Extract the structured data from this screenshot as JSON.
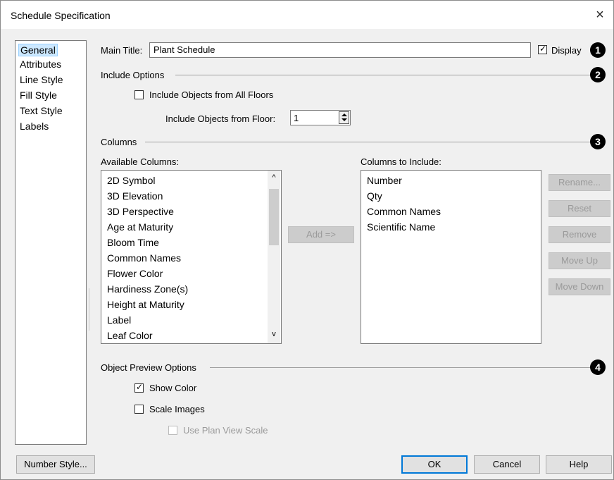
{
  "window": {
    "title": "Schedule Specification",
    "close_glyph": "×"
  },
  "sidebar": {
    "items": [
      "General",
      "Attributes",
      "Line Style",
      "Fill Style",
      "Text Style",
      "Labels"
    ],
    "selected": "General"
  },
  "main_title": {
    "label": "Main Title:",
    "value": "Plant Schedule",
    "display_label": "Display",
    "display_checked": true
  },
  "include_options": {
    "heading": "Include Options",
    "all_floors_label": "Include Objects from All Floors",
    "all_floors_checked": false,
    "from_floor_label": "Include Objects from Floor:",
    "from_floor_value": "1"
  },
  "columns": {
    "heading": "Columns",
    "available_label": "Available Columns:",
    "available": [
      "2D Symbol",
      "3D Elevation",
      "3D Perspective",
      "Age at Maturity",
      "Bloom Time",
      "Common Names",
      "Flower Color",
      "Hardiness Zone(s)",
      "Height at Maturity",
      "Label",
      "Leaf Color"
    ],
    "include_label": "Columns to Include:",
    "included": [
      "Number",
      "Qty",
      "Common Names",
      "Scientific Name"
    ],
    "add_button": "Add =>",
    "rename_button": "Rename...",
    "reset_button": "Reset",
    "remove_button": "Remove",
    "move_up_button": "Move Up",
    "move_down_button": "Move Down"
  },
  "preview": {
    "heading": "Object Preview Options",
    "show_color_label": "Show Color",
    "show_color_checked": true,
    "scale_images_label": "Scale Images",
    "scale_images_checked": false,
    "plan_scale_label": "Use Plan View Scale",
    "plan_scale_checked": false
  },
  "callouts": [
    "1",
    "2",
    "3",
    "4"
  ],
  "footer": {
    "number_style": "Number Style...",
    "ok": "OK",
    "cancel": "Cancel",
    "help": "Help"
  },
  "colors": {
    "selection": "#cce8ff",
    "accent": "#0078d7",
    "dialog_bg": "#f0f0f0"
  }
}
